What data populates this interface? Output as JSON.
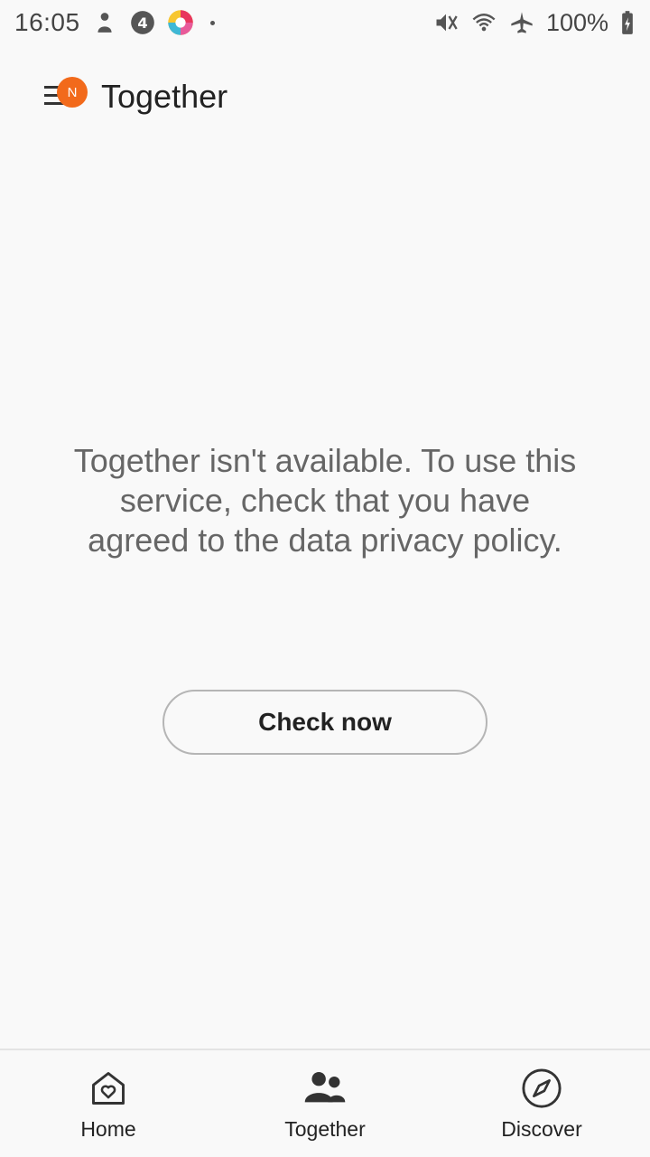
{
  "status_bar": {
    "time": "16:05",
    "battery": "100%",
    "left_icons": [
      "lock-person-icon",
      "four-circle-icon",
      "colorful-app-icon"
    ],
    "right_icons": [
      "mute-icon",
      "wifi-icon",
      "airplane-icon",
      "battery-charging-icon"
    ]
  },
  "app_bar": {
    "title": "Together",
    "menu_badge": "N",
    "badge_color": "#f26a1b"
  },
  "main": {
    "message": "Together isn't available. To use this service, check that you have agreed to the data privacy policy.",
    "check_button": "Check now"
  },
  "bottom_nav": {
    "items": [
      {
        "label": "Home",
        "icon": "home-heart-icon"
      },
      {
        "label": "Together",
        "icon": "people-icon"
      },
      {
        "label": "Discover",
        "icon": "compass-icon"
      }
    ]
  }
}
